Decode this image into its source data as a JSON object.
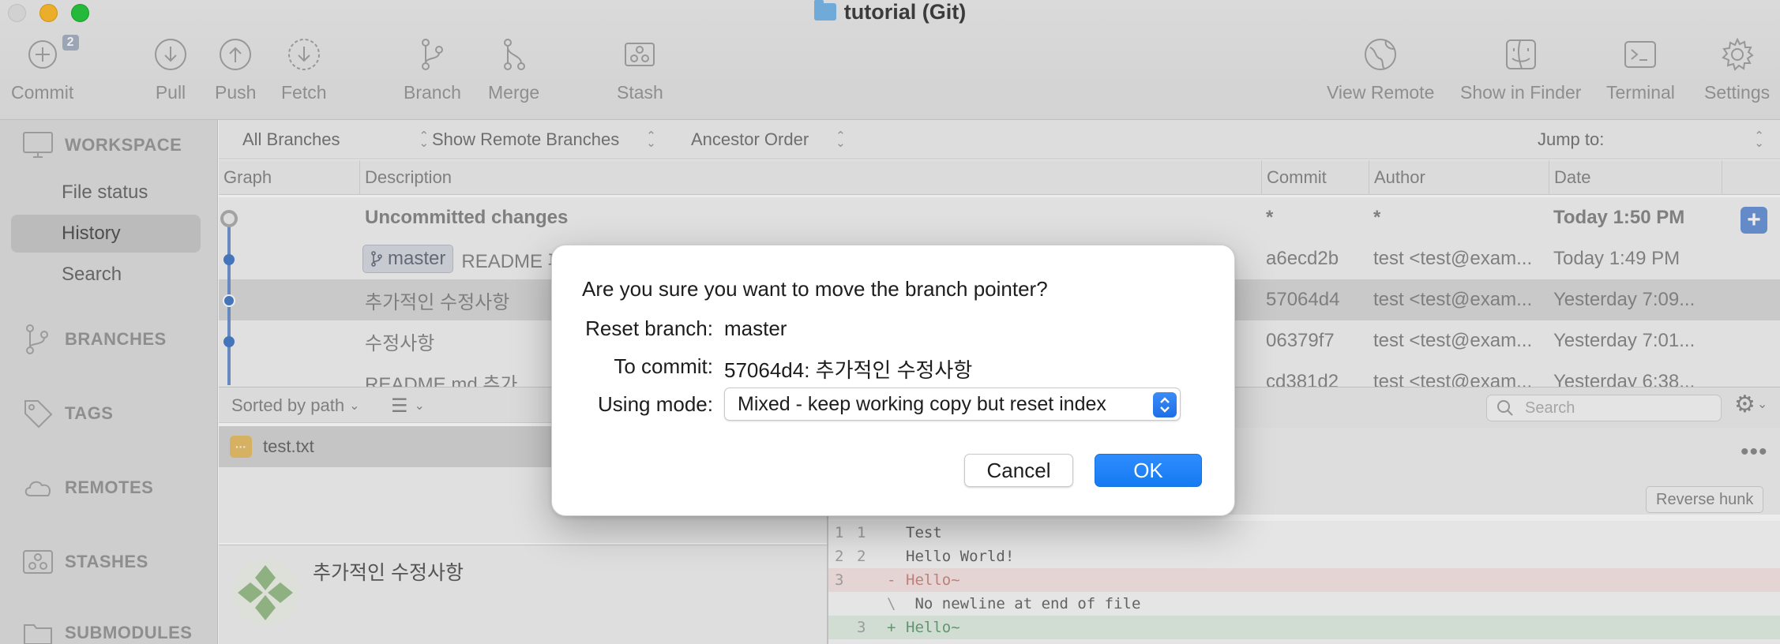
{
  "window": {
    "title": "tutorial (Git)"
  },
  "toolbar": {
    "commit_label": "Commit",
    "commit_badge": "2",
    "pull_label": "Pull",
    "push_label": "Push",
    "fetch_label": "Fetch",
    "branch_label": "Branch",
    "merge_label": "Merge",
    "stash_label": "Stash",
    "view_remote_label": "View Remote",
    "show_in_finder_label": "Show in Finder",
    "terminal_label": "Terminal",
    "settings_label": "Settings"
  },
  "sidebar": {
    "workspace": "WORKSPACE",
    "items": [
      {
        "label": "File status"
      },
      {
        "label": "History",
        "active": true
      },
      {
        "label": "Search"
      }
    ],
    "branches": "BRANCHES",
    "tags": "TAGS",
    "remotes": "REMOTES",
    "stashes": "STASHES",
    "submodules": "SUBMODULES"
  },
  "filters": {
    "branches": "All Branches",
    "remote": "Show Remote Branches",
    "order": "Ancestor Order",
    "jump_to": "Jump to:"
  },
  "table": {
    "headers": {
      "graph": "Graph",
      "description": "Description",
      "commit": "Commit",
      "author": "Author",
      "date": "Date"
    },
    "rows": [
      {
        "description": "Uncommitted changes",
        "commit": "*",
        "author": "*",
        "date": "Today 1:50 PM"
      },
      {
        "branch": "master",
        "description": "README 파",
        "commit": "a6ecd2b",
        "author": "test <test@exam...",
        "date": "Today 1:49 PM"
      },
      {
        "description": "추가적인 수정사항",
        "commit": "57064d4",
        "author": "test <test@exam...",
        "date": "Yesterday 7:09..."
      },
      {
        "description": "수정사항",
        "commit": "06379f7",
        "author": "test <test@exam...",
        "date": "Yesterday 7:01..."
      },
      {
        "description": "README.md 추가",
        "commit": "cd381d2",
        "author": "test <test@exam...",
        "date": "Yesterday 6:38..."
      }
    ]
  },
  "files": {
    "sort_label": "Sorted by path",
    "list": [
      {
        "name": "test.txt"
      }
    ]
  },
  "commit_detail": {
    "message": "추가적인 수정사항"
  },
  "diff": {
    "search_placeholder": "Search",
    "reverse_hunk": "Reverse hunk",
    "lines": [
      {
        "old": "1",
        "new": "1",
        "sign": "",
        "text": "Test",
        "type": "context"
      },
      {
        "old": "2",
        "new": "2",
        "sign": "",
        "text": "Hello World!",
        "type": "context"
      },
      {
        "old": "3",
        "new": "",
        "sign": "-",
        "text": "Hello~",
        "type": "removed"
      },
      {
        "old": "",
        "new": "",
        "sign": "\\",
        "text": " No newline at end of file",
        "type": "note"
      },
      {
        "old": "",
        "new": "3",
        "sign": "+",
        "text": "Hello~",
        "type": "added"
      }
    ]
  },
  "dialog": {
    "question": "Are you sure you want to move the branch pointer?",
    "reset_branch_label": "Reset branch:",
    "reset_branch_value": "master",
    "to_commit_label": "To commit:",
    "to_commit_value": "57064d4: 추가적인 수정사항",
    "mode_label": "Using mode:",
    "mode_value": "Mixed - keep working copy but reset index",
    "cancel": "Cancel",
    "ok": "OK"
  },
  "colors": {
    "accent": "#1a7ff5",
    "graph_line": "#4a7fc9",
    "added_text": "#6aa37a",
    "removed_text": "#d08a84"
  }
}
